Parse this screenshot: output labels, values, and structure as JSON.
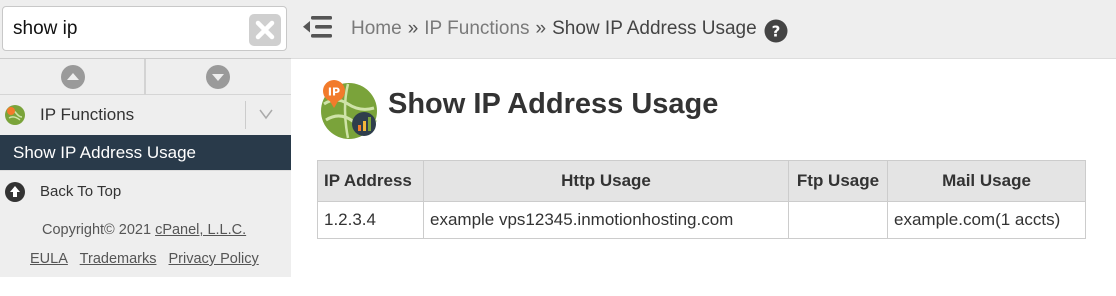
{
  "search": {
    "value": "show ip"
  },
  "sidebar": {
    "group_label": "IP Functions",
    "active_item": "Show IP Address Usage",
    "back_to_top": "Back To Top",
    "copyright_prefix": "Copyright© 2021",
    "copyright_link": "cPanel, L.L.C.",
    "links": [
      "EULA",
      "Trademarks",
      "Privacy Policy"
    ]
  },
  "breadcrumb": {
    "home": "Home",
    "section": "IP Functions",
    "current": "Show IP Address Usage",
    "separator": "»"
  },
  "page": {
    "title": "Show IP Address Usage"
  },
  "table": {
    "headers": [
      "IP Address",
      "Http Usage",
      "Ftp Usage",
      "Mail Usage"
    ],
    "rows": [
      [
        "1.2.3.4",
        "example vps12345.inmotionhosting.com",
        "",
        "example.com(1 accts)"
      ]
    ]
  },
  "colors": {
    "active_bg": "#293a4a",
    "sidebar_bg": "#eeeeee",
    "header_cell_bg": "#e4e4e4",
    "icon_green": "#7aa33a",
    "icon_orange": "#f27b2b"
  },
  "icons": [
    "clear-icon",
    "scroll-up-icon",
    "scroll-down-icon",
    "ip-functions-icon",
    "chevron-down-icon",
    "back-to-top-icon",
    "menu-toggle-icon",
    "help-icon",
    "ip-usage-icon"
  ]
}
